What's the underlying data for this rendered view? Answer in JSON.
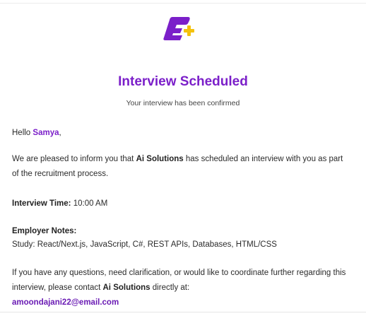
{
  "header": {
    "logo_icon": "e-plus-logo-icon",
    "brand_color": "#7b1fc9",
    "plus_color": "#f4c20d"
  },
  "title": "Interview Scheduled",
  "subtitle": "Your interview has been confirmed",
  "greeting": {
    "prefix": "Hello ",
    "name": "Samya",
    "suffix": ","
  },
  "intro": {
    "part1": "We are pleased to inform you that ",
    "company": "Ai Solutions",
    "part2": " has scheduled an interview with you as part of the recruitment process."
  },
  "interview_time": {
    "label": "Interview Time:",
    "value": " 10:00 AM"
  },
  "employer_notes": {
    "label": "Employer Notes:",
    "text": "Study: React/Next.js, JavaScript, C#, REST APIs, Databases, HTML/CSS"
  },
  "contact": {
    "part1": "If you have any questions, need clarification, or would like to coordinate further regarding this interview, please contact ",
    "company": "Ai Solutions",
    "part2": " directly at:",
    "email": "amoondajani22@email.com"
  }
}
